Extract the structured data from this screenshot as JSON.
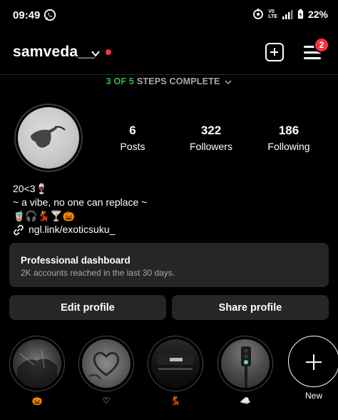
{
  "status_bar": {
    "time": "09:49",
    "network_top": "V0",
    "network_bottom": "LTE",
    "battery": "22%",
    "icons": [
      "whatsapp-icon",
      "hotspot-icon",
      "signal-icon",
      "battery-icon"
    ]
  },
  "header": {
    "username": "samveda__",
    "notification_count": "2"
  },
  "steps": {
    "done": "3 OF 5",
    "rest": "STEPS COMPLETE"
  },
  "stats": [
    {
      "value": "6",
      "label": "Posts"
    },
    {
      "value": "322",
      "label": "Followers"
    },
    {
      "value": "186",
      "label": "Following"
    }
  ],
  "bio": {
    "line1": "20<3🍷",
    "line2": "~ a vibe, no one can replace ~",
    "emojis": "🧋🎧💃🍸🎃",
    "link": "ngl.link/exoticsuku_"
  },
  "dashboard": {
    "title": "Professional dashboard",
    "subtitle": "2K accounts reached in the last 30 days."
  },
  "buttons": {
    "edit": "Edit profile",
    "share": "Share profile"
  },
  "highlights": [
    {
      "label": "🎃"
    },
    {
      "label": "♡"
    },
    {
      "label": "💃"
    },
    {
      "label": "☁️"
    }
  ],
  "new_highlight": {
    "label": "New"
  },
  "colors": {
    "accent_red": "#ff3040",
    "steps_green": "#2dba4e",
    "card_bg": "#262626"
  }
}
